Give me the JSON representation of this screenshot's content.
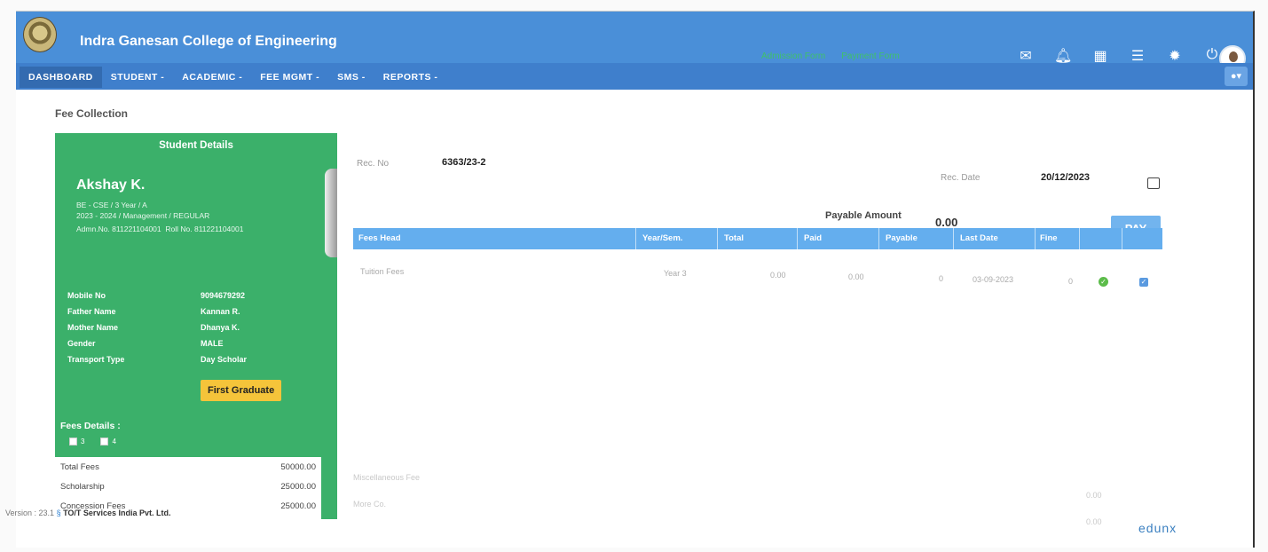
{
  "header": {
    "college_name": "Indra Ganesan College of Engineering",
    "links": [
      "Admission Form",
      "Payment Form"
    ],
    "icons": [
      "chat-icon",
      "notification-icon",
      "calendar-icon",
      "list-icon",
      "gear-icon",
      "power-icon"
    ],
    "brand_color": "#4a8fd8"
  },
  "nav": {
    "items": [
      "DASHBOARD",
      "STUDENT -",
      "ACADEMIC -",
      "FEE MGMT -",
      "SMS -",
      "REPORTS -"
    ]
  },
  "page": {
    "title": "Fee Collection"
  },
  "student": {
    "heading": "Student Details",
    "name": "Akshay K.",
    "course_line": "BE - CSE / 3 Year / A",
    "year_line": "2023 - 2024 / Management / REGULAR",
    "adm_label": "Admn.No.",
    "adm_no": "811221104001",
    "roll_label": "Roll No.",
    "roll_no": "811221104001",
    "details": [
      {
        "key": "Mobile No",
        "value": "9094679292"
      },
      {
        "key": "Father Name",
        "value": "Kannan R."
      },
      {
        "key": "Mother Name",
        "value": "Dhanya K."
      },
      {
        "key": "Gender",
        "value": "MALE"
      },
      {
        "key": "Transport Type",
        "value": "Day Scholar"
      }
    ],
    "badge": "First Graduate",
    "fees_details_label": "Fees Details :",
    "sem_checks": [
      "3",
      "4"
    ],
    "summary": [
      {
        "label": "Total Fees",
        "value": "50000.00"
      },
      {
        "label": "Scholarship",
        "value": "25000.00"
      },
      {
        "label": "Concession Fees",
        "value": "25000.00"
      }
    ]
  },
  "form": {
    "rec_no_label": "Rec. No",
    "rec_no": "6363/23-2",
    "rec_date_label": "Rec. Date",
    "rec_date": "20/12/2023",
    "payable_label": "Payable Amount",
    "payable_amount": "0.00",
    "pay_label": "PAY"
  },
  "table": {
    "headers": [
      "Fees Head",
      "Year/Sem.",
      "Total",
      "Paid",
      "Payable",
      "Last Date",
      "Fine"
    ],
    "rows": [
      [
        "Tuition Fees",
        "Year 3",
        "0.00",
        "0.00",
        "0",
        "03-09-2023",
        "0"
      ]
    ]
  },
  "extra": {
    "misc_label": "Miscellaneous Fee",
    "more_label": "More Co.",
    "misc_value": "0.00",
    "more_value": "0.00"
  },
  "footer": {
    "version": "Version : 23.1",
    "company": "TO/T Services India Pvt. Ltd.",
    "brand": "edunx"
  }
}
